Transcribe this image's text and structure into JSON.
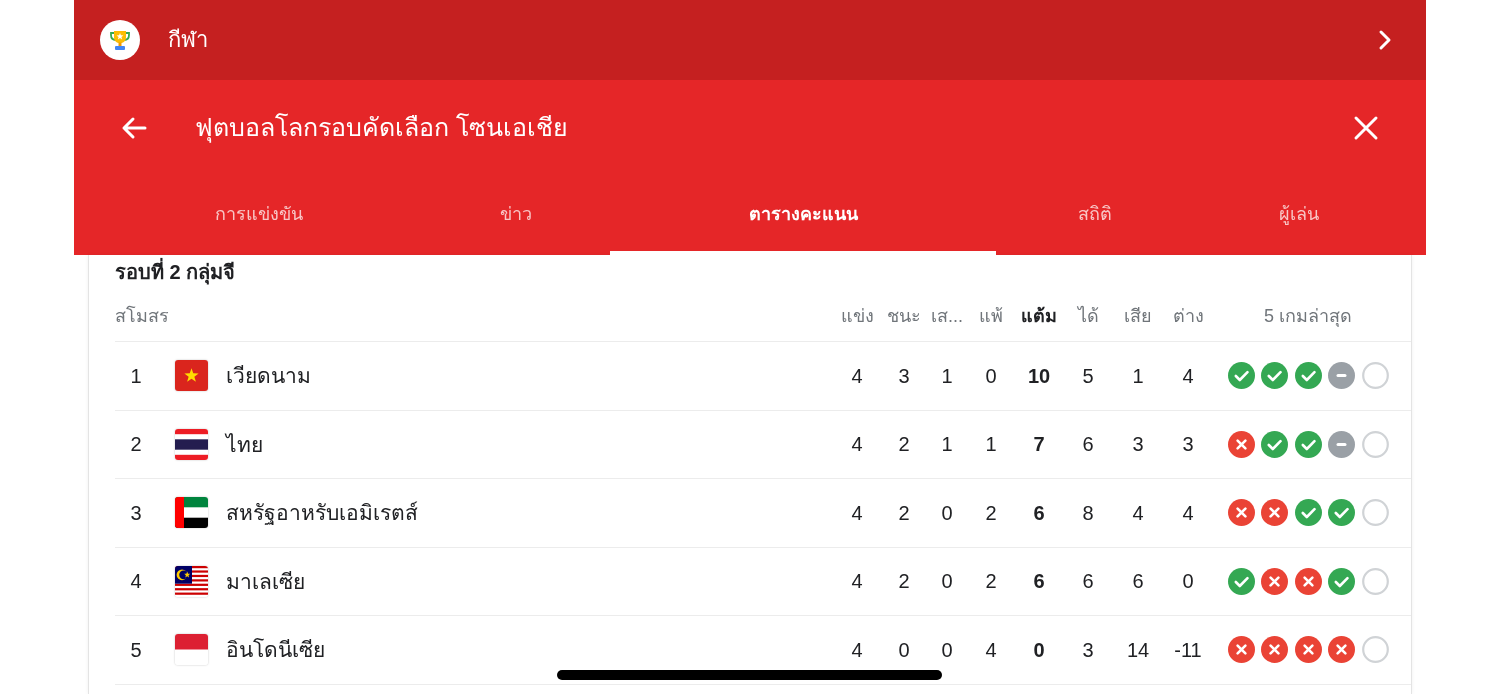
{
  "top_bar": {
    "title": "กีฬา"
  },
  "header": {
    "title": "ฟุตบอลโลกรอบคัดเลือก โซนเอเชีย"
  },
  "tabs": [
    {
      "label": "การแข่งขัน",
      "selected": false
    },
    {
      "label": "ข่าว",
      "selected": false
    },
    {
      "label": "ตารางคะแนน",
      "selected": true
    },
    {
      "label": "สถิติ",
      "selected": false
    },
    {
      "label": "ผู้เล่น",
      "selected": false
    }
  ],
  "standings": {
    "group_title": "รอบที่ 2 กลุ่มจี",
    "columns": [
      {
        "label": "สโมสร",
        "emphasized": false
      },
      {
        "label": "แข่ง",
        "emphasized": false
      },
      {
        "label": "ชนะ",
        "emphasized": false
      },
      {
        "label": "เส...",
        "emphasized": false
      },
      {
        "label": "แพ้",
        "emphasized": false
      },
      {
        "label": "แต้ม",
        "emphasized": true
      },
      {
        "label": "ได้",
        "emphasized": false
      },
      {
        "label": "เสีย",
        "emphasized": false
      },
      {
        "label": "ต่าง",
        "emphasized": false
      },
      {
        "label": "5 เกมล่าสุด",
        "emphasized": false
      }
    ],
    "rows": [
      {
        "rank": "1",
        "flag": {
          "kind": "vietnam"
        },
        "team": "เวียดนาม",
        "stats": [
          "4",
          "3",
          "1",
          "0",
          "10",
          "5",
          "1",
          "4"
        ],
        "form": [
          {
            "kind": "win"
          },
          {
            "kind": "win"
          },
          {
            "kind": "win"
          },
          {
            "kind": "draw"
          },
          {
            "kind": "empty"
          }
        ]
      },
      {
        "rank": "2",
        "flag": {
          "kind": "thailand"
        },
        "team": "ไทย",
        "stats": [
          "4",
          "2",
          "1",
          "1",
          "7",
          "6",
          "3",
          "3"
        ],
        "form": [
          {
            "kind": "loss"
          },
          {
            "kind": "win"
          },
          {
            "kind": "win"
          },
          {
            "kind": "draw"
          },
          {
            "kind": "empty"
          }
        ]
      },
      {
        "rank": "3",
        "flag": {
          "kind": "uae"
        },
        "team": "สหรัฐอาหรับเอมิเรตส์",
        "stats": [
          "4",
          "2",
          "0",
          "2",
          "6",
          "8",
          "4",
          "4"
        ],
        "form": [
          {
            "kind": "loss"
          },
          {
            "kind": "loss"
          },
          {
            "kind": "win"
          },
          {
            "kind": "win"
          },
          {
            "kind": "empty"
          }
        ]
      },
      {
        "rank": "4",
        "flag": {
          "kind": "malaysia"
        },
        "team": "มาเลเซีย",
        "stats": [
          "4",
          "2",
          "0",
          "2",
          "6",
          "6",
          "6",
          "0"
        ],
        "form": [
          {
            "kind": "win"
          },
          {
            "kind": "loss"
          },
          {
            "kind": "loss"
          },
          {
            "kind": "win"
          },
          {
            "kind": "empty"
          }
        ]
      },
      {
        "rank": "5",
        "flag": {
          "kind": "indonesia"
        },
        "team": "อินโดนีเซีย",
        "stats": [
          "4",
          "0",
          "0",
          "4",
          "0",
          "3",
          "14",
          "-11"
        ],
        "form": [
          {
            "kind": "loss"
          },
          {
            "kind": "loss"
          },
          {
            "kind": "loss"
          },
          {
            "kind": "loss"
          },
          {
            "kind": "empty"
          }
        ]
      }
    ]
  }
}
